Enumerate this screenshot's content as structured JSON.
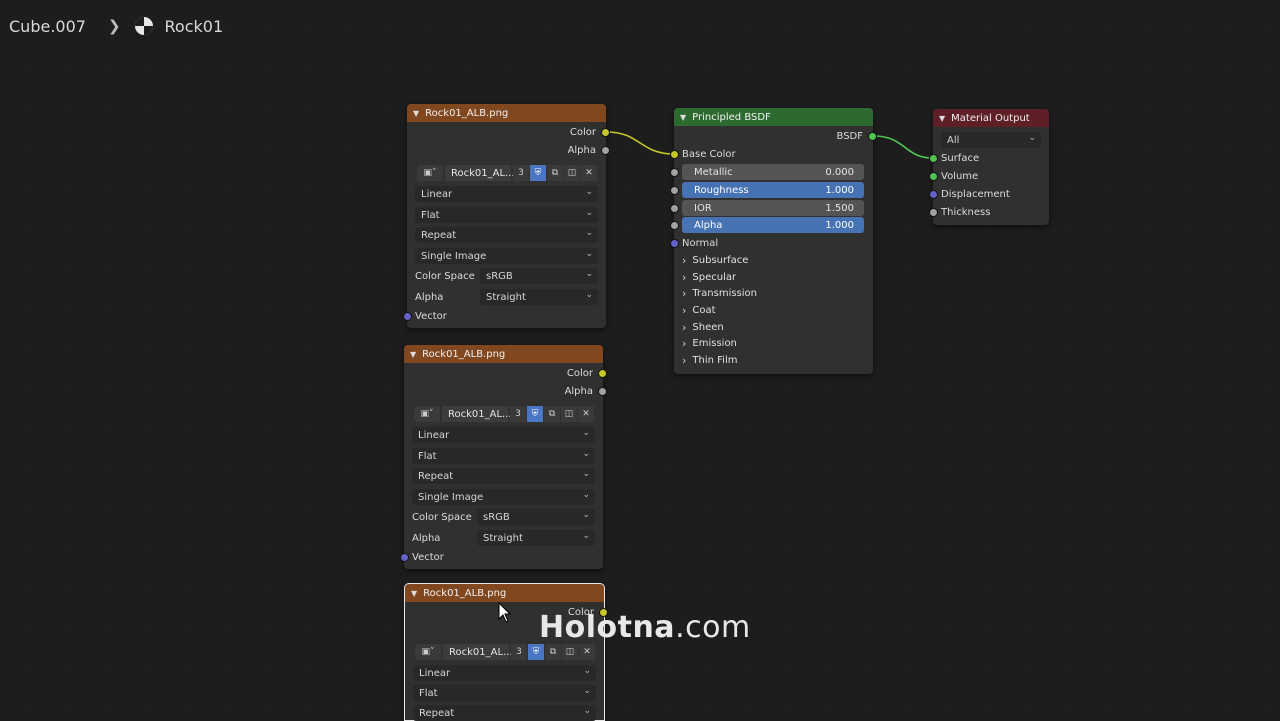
{
  "breadcrumb": {
    "object": "Cube.007",
    "material": "Rock01"
  },
  "tex_nodes": [
    {
      "title": "Rock01_ALB.png",
      "outputs": {
        "color": "Color",
        "alpha": "Alpha"
      },
      "image": {
        "name": "Rock01_AL...",
        "users": "3"
      },
      "interpolation": "Linear",
      "projection": "Flat",
      "extension": "Repeat",
      "source": "Single Image",
      "color_space_label": "Color Space",
      "color_space": "sRGB",
      "alpha_label": "Alpha",
      "alpha_mode": "Straight",
      "vector": "Vector"
    },
    {
      "title": "Rock01_ALB.png",
      "outputs": {
        "color": "Color",
        "alpha": "Alpha"
      },
      "image": {
        "name": "Rock01_AL...",
        "users": "3"
      },
      "interpolation": "Linear",
      "projection": "Flat",
      "extension": "Repeat",
      "source": "Single Image",
      "color_space_label": "Color Space",
      "color_space": "sRGB",
      "alpha_label": "Alpha",
      "alpha_mode": "Straight",
      "vector": "Vector"
    },
    {
      "title": "Rock01_ALB.png",
      "outputs": {
        "color": "Color"
      },
      "image": {
        "name": "Rock01_AL...",
        "users": "3"
      },
      "interpolation": "Linear",
      "projection": "Flat",
      "extension": "Repeat"
    }
  ],
  "bsdf": {
    "title": "Principled BSDF",
    "output": "BSDF",
    "base_color": "Base Color",
    "metallic": {
      "label": "Metallic",
      "value": "0.000"
    },
    "roughness": {
      "label": "Roughness",
      "value": "1.000"
    },
    "ior": {
      "label": "IOR",
      "value": "1.500"
    },
    "alpha": {
      "label": "Alpha",
      "value": "1.000"
    },
    "normal": "Normal",
    "panels": [
      "Subsurface",
      "Specular",
      "Transmission",
      "Coat",
      "Sheen",
      "Emission",
      "Thin Film"
    ]
  },
  "output_node": {
    "title": "Material Output",
    "target": "All",
    "inputs": [
      "Surface",
      "Volume",
      "Displacement",
      "Thickness"
    ]
  },
  "watermark": {
    "bold": "Holotna",
    "rest": ".com"
  },
  "colors": {
    "texture_header": "#81471f",
    "bsdf_header": "#2c6a2f",
    "output_header": "#5e1f27",
    "field_blue": "#4772b3",
    "link_yellow": "#c7c729",
    "link_green": "#4fc451"
  }
}
